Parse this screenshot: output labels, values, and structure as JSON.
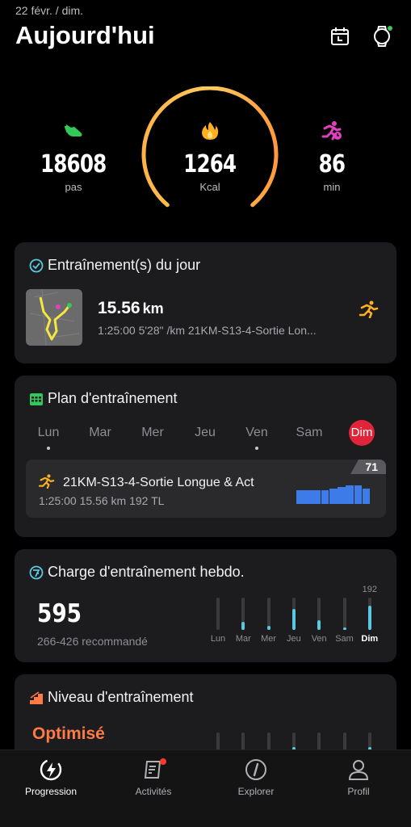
{
  "header": {
    "date": "22 févr. / dim.",
    "title": "Aujourd'hui",
    "icons": [
      "calendar-icon",
      "watch-icon"
    ]
  },
  "stats": {
    "steps": {
      "value": "18608",
      "unit": "pas",
      "icon": "shoe-icon",
      "color": "#34c759"
    },
    "calories": {
      "value": "1264",
      "unit": "Kcal",
      "icon": "flame-icon",
      "color": "#ffb020"
    },
    "minutes": {
      "value": "86",
      "unit": "min",
      "icon": "active-runner-icon",
      "color": "#e040c0"
    },
    "ring_progress": 0.72
  },
  "workout": {
    "title": "Entraînement(s) du jour",
    "distance": "15.56",
    "distance_unit": "km",
    "meta": "1:25:00   5'28\" /km  21KM-S13-4-Sortie Lon...",
    "icon": "running-icon"
  },
  "plan": {
    "title": "Plan d'entraînement",
    "days": [
      {
        "label": "Lun",
        "dot": true
      },
      {
        "label": "Mar",
        "dot": false
      },
      {
        "label": "Mer",
        "dot": false
      },
      {
        "label": "Jeu",
        "dot": false
      },
      {
        "label": "Ven",
        "dot": true
      },
      {
        "label": "Sam",
        "dot": false
      },
      {
        "label": "Dim",
        "dot": false,
        "active": true
      }
    ],
    "session": {
      "name": "21KM-S13-4-Sortie Longue & Act",
      "meta": "1:25:00  15.56 km  192 TL",
      "badge": "71",
      "intensity_profile": [
        0.72,
        0.72,
        0.72,
        0.72,
        0.8,
        0.86,
        0.95,
        0.95,
        0.8
      ]
    }
  },
  "load": {
    "title": "Charge d'entraînement hebdo.",
    "value": "595",
    "recommended": "266-426 recommandé",
    "max_label": "192",
    "days": [
      {
        "label": "Lun",
        "value": 0
      },
      {
        "label": "Mar",
        "value": 0.25
      },
      {
        "label": "Mer",
        "value": 0.12
      },
      {
        "label": "Jeu",
        "value": 0.65
      },
      {
        "label": "Ven",
        "value": 0.3
      },
      {
        "label": "Sam",
        "value": 0.08
      },
      {
        "label": "Dim",
        "value": 0.75
      }
    ]
  },
  "level": {
    "title": "Niveau d'entraînement",
    "status": "Optimisé",
    "status_color": "#ff7a45"
  },
  "tabs": [
    {
      "label": "Progression",
      "icon": "bolt-icon",
      "active": true
    },
    {
      "label": "Activités",
      "icon": "activity-list-icon",
      "active": false,
      "badge": true
    },
    {
      "label": "Explorer",
      "icon": "compass-icon",
      "active": false
    },
    {
      "label": "Profil",
      "icon": "profile-icon",
      "active": false
    }
  ]
}
